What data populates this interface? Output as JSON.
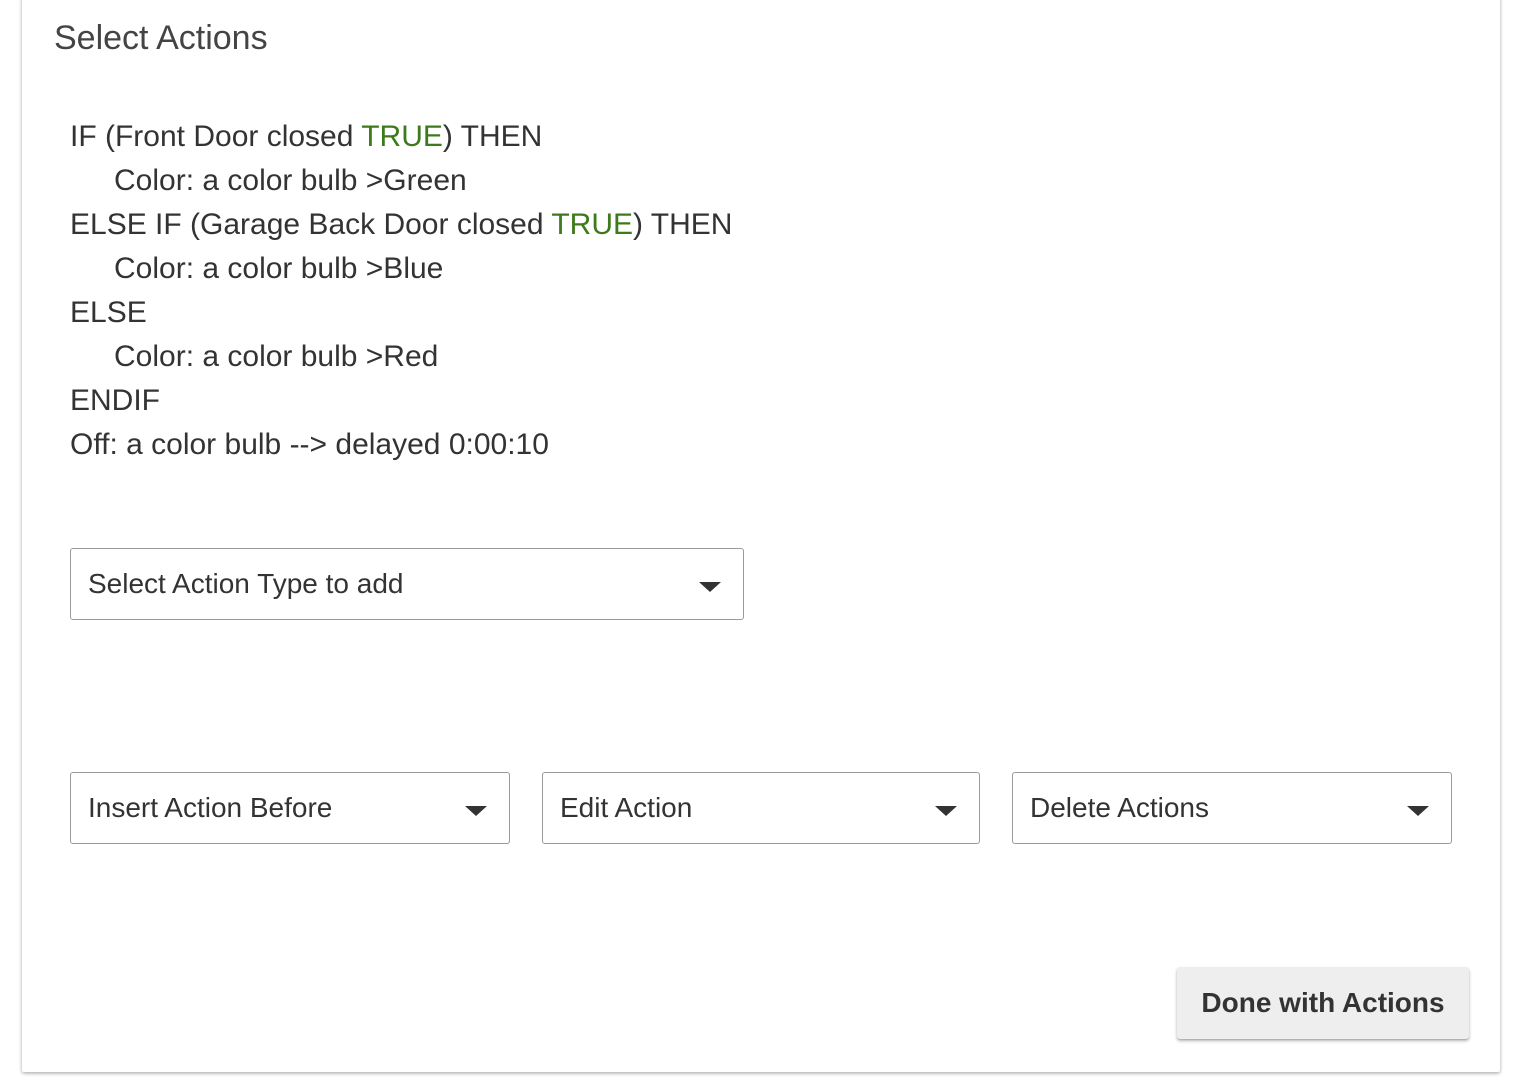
{
  "section": {
    "title": "Select Actions"
  },
  "actions": {
    "lines": [
      {
        "pre": "IF (Front Door closed ",
        "highlight": "TRUE",
        "post": ") THEN"
      },
      {
        "text": "Color: a color bulb >Green"
      },
      {
        "pre": "ELSE IF (Garage Back Door closed ",
        "highlight": "TRUE",
        "post": ") THEN"
      },
      {
        "text": "Color: a color bulb >Blue"
      },
      {
        "text": "ELSE"
      },
      {
        "text": "Color: a color bulb >Red"
      },
      {
        "text": "ENDIF"
      },
      {
        "text": "Off: a color bulb --> delayed 0:00:10"
      }
    ]
  },
  "controls": {
    "action_type_select": "Select Action Type to add",
    "insert_before_select": "Insert Action Before",
    "edit_select": "Edit Action",
    "delete_select": "Delete Actions",
    "done_button": "Done with Actions"
  },
  "colors": {
    "true_highlight": "#3c7a1c",
    "text": "#333333",
    "button_bg": "#eeeeee"
  },
  "icons": {
    "dropdown": "caret-down-icon"
  }
}
